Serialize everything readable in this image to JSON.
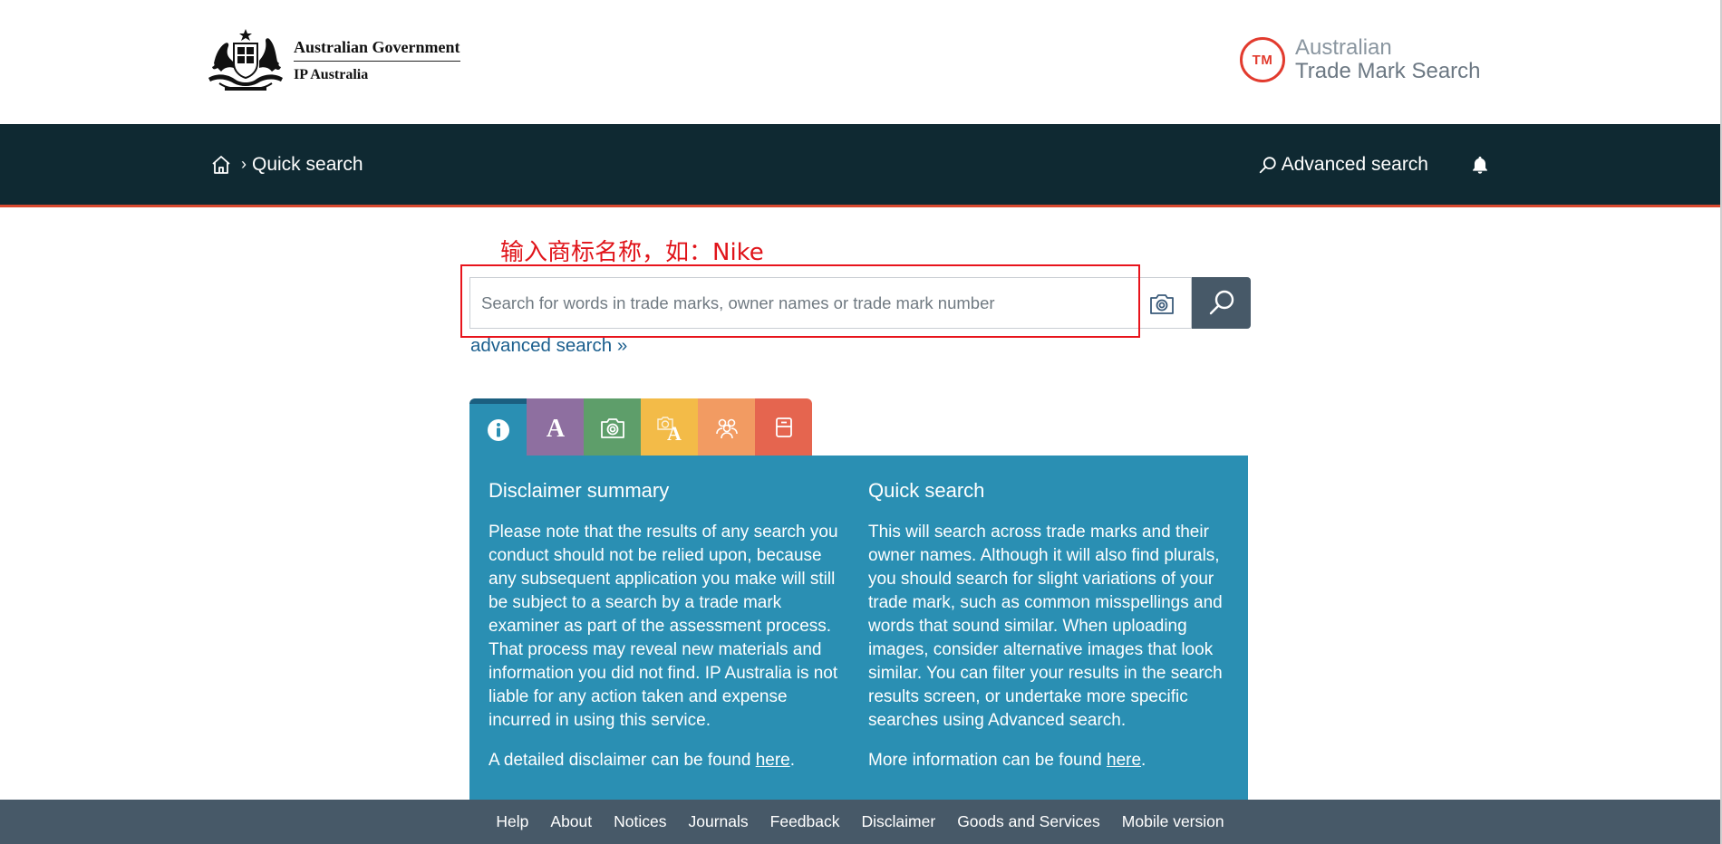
{
  "header": {
    "gov_name": "Australian Government",
    "gov_dept": "IP Australia",
    "atms_badge": "TM",
    "atms_line1": "Australian",
    "atms_line2": "Trade Mark Search"
  },
  "nav": {
    "breadcrumb_current": "Quick search",
    "breadcrumb_separator": "›",
    "advanced_search_label": "Advanced search"
  },
  "annotation": {
    "text": "输入商标名称，如：Nike"
  },
  "search": {
    "value": "",
    "placeholder": "Search for words in trade marks, owner names or trade mark number",
    "advanced_link": "advanced search »"
  },
  "tabs": [
    {
      "icon": "info-icon",
      "color": "#2a8fb3"
    },
    {
      "icon": "word-icon",
      "color": "#8e6fa0"
    },
    {
      "icon": "image-icon",
      "color": "#5e9e6a"
    },
    {
      "icon": "image-word-icon",
      "color": "#f3bb48"
    },
    {
      "icon": "owner-icon",
      "color": "#f29b62"
    },
    {
      "icon": "archive-icon",
      "color": "#e5654f"
    }
  ],
  "panel": {
    "left": {
      "title": "Disclaimer summary",
      "body": "Please note that the results of any search you conduct should not be relied upon, because any subsequent application you make will still be subject to a search by a trade mark examiner as part of the assessment process. That process may reveal new materials and information you did not find. IP Australia is not liable for any action taken and expense incurred in using this service.",
      "more_prefix": "A detailed disclaimer can be found ",
      "more_link": "here",
      "more_suffix": "."
    },
    "right": {
      "title": "Quick search",
      "body": "This will search across trade marks and their owner names. Although it will also find plurals, you should search for slight variations of your trade mark, such as common misspellings and words that sound similar. When uploading images, consider alternative images that look similar. You can filter your results in the search results screen, or undertake more specific searches using Advanced search.",
      "more_prefix": "More information can be found ",
      "more_link": "here",
      "more_suffix": "."
    }
  },
  "footer": {
    "links": [
      "Help",
      "About",
      "Notices",
      "Journals",
      "Feedback",
      "Disclaimer",
      "Goods and Services",
      "Mobile version"
    ]
  },
  "colors": {
    "nav_bg": "#0f2932",
    "nav_accent": "#d9492f",
    "panel_bg": "#2a8fb3",
    "footer_bg": "#475968",
    "search_button": "#475968",
    "link": "#1b5f8e",
    "annotation": "#e8141c",
    "brand_red": "#e23b2e"
  }
}
